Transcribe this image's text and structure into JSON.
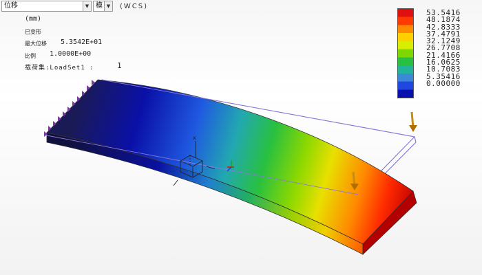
{
  "toolbar": {
    "result_select": "位移",
    "component_select": "模"
  },
  "coordinate_system": "(WCS)",
  "info": {
    "units": "(mm)",
    "deformed_label": "已变形",
    "max_disp_label": "最大位移",
    "max_disp_value": "5.3542E+01",
    "scale_label": "比例",
    "scale_value": "1.0000E+00",
    "loadset_label": "载荷集:LoadSet1 :",
    "loadset_value": "1"
  },
  "legend": {
    "values": [
      "53.5416",
      "48.1874",
      "42.8333",
      "37.4791",
      "32.1249",
      "26.7708",
      "21.4166",
      "16.0625",
      "10.7083",
      "5.35416",
      "0.00000"
    ],
    "colors": [
      "#e01010",
      "#ff3a00",
      "#ff8a00",
      "#ffd000",
      "#d8ee00",
      "#7ed800",
      "#28c040",
      "#22b49a",
      "#3a8ad8",
      "#2047e0",
      "#0a10b0"
    ]
  },
  "icons": [
    "triad-icon",
    "origin-csys-icon",
    "load-arrow-icon",
    "constraint-icon"
  ]
}
